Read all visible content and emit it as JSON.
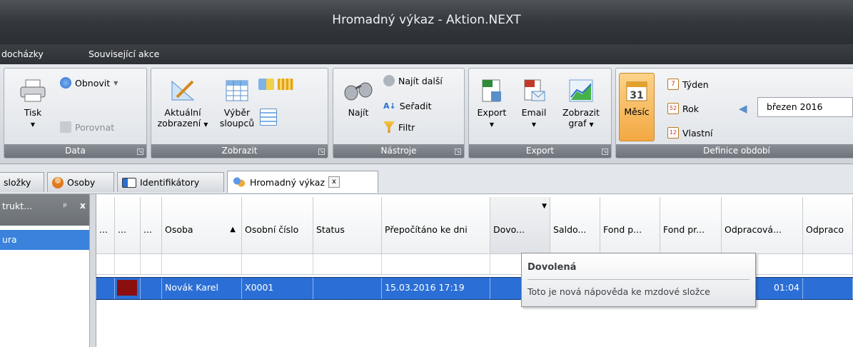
{
  "window": {
    "title": "Hromadný výkaz - Aktion.NEXT"
  },
  "menu": {
    "items": [
      "docházky",
      "Související akce"
    ]
  },
  "ribbon": {
    "data_group": {
      "caption": "Data",
      "print_label": "Tisk",
      "refresh_label": "Obnovit",
      "compare_label": "Porovnat"
    },
    "view_group": {
      "caption": "Zobrazit",
      "current_view_label_1": "Aktuální",
      "current_view_label_2": "zobrazení",
      "columns_label_1": "Výběr",
      "columns_label_2": "sloupců"
    },
    "tools_group": {
      "caption": "Nástroje",
      "find_label": "Najít",
      "find_next_label": "Najít další",
      "sort_label": "Seřadit",
      "filter_label": "Filtr"
    },
    "export_group": {
      "caption": "Export",
      "export_label": "Export",
      "email_label": "Email",
      "chart_label_1": "Zobrazit",
      "chart_label_2": "graf"
    },
    "period_group": {
      "caption": "Definice období",
      "month_label": "Měsíc",
      "week_label": "Týden",
      "year_label": "Rok",
      "custom_label": "Vlastní",
      "period_value": "březen 2016"
    }
  },
  "tabs": [
    {
      "label": "složky"
    },
    {
      "label": "Osoby"
    },
    {
      "label": "Identifikátory"
    },
    {
      "label": "Hromadný výkaz",
      "close": "x"
    }
  ],
  "left_panel": {
    "title": "trukt...",
    "pin": "ᵖ",
    "close": "x",
    "item": "ura"
  },
  "grid": {
    "headers": [
      "...",
      "...",
      "...",
      "Osoba",
      "Osobní číslo",
      "Status",
      "Přepočítáno ke dni",
      "Dovo...",
      "Saldo...",
      "Fond p...",
      "Fond pr...",
      "Odpracová...",
      "Odpraco"
    ],
    "sort_indicator": "▲",
    "filter_indicator": "▼",
    "row": {
      "osoba": "Novák Karel",
      "cislo": "X0001",
      "prepocitano": "15.03.2016 17:19",
      "odpracovano": "01:04"
    }
  },
  "tooltip": {
    "title": "Dovolená",
    "text": "Toto je nová nápověda ke mzdové složce"
  },
  "colors": {
    "selection": "#2b6fd6",
    "status_red": "#8b0f0f",
    "accent_orange": "#f5b24a"
  }
}
